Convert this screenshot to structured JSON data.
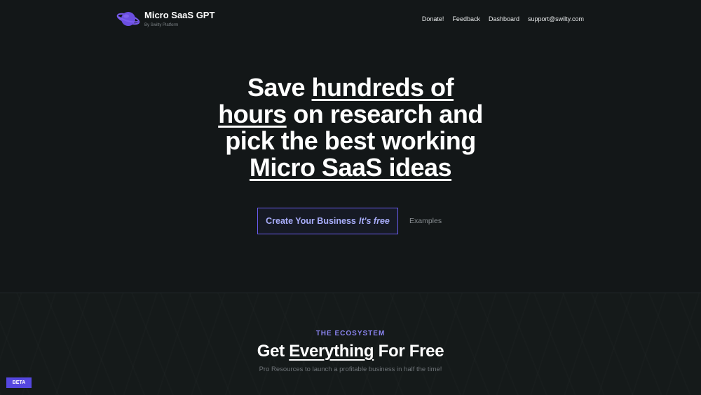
{
  "brand": {
    "name": "Micro SaaS GPT",
    "subtitle": "By Swilty Platform",
    "logo_icon": "planet-icon",
    "logo_color": "#6b4fe0"
  },
  "nav": {
    "items": [
      "Donate!",
      "Feedback",
      "Dashboard",
      "support@swilty.com"
    ]
  },
  "hero": {
    "title_parts": {
      "p1": "Save ",
      "p2": "hundreds of",
      "p3": "hours",
      "p4": " on research and",
      "p5": "pick the best working",
      "p6": "Micro SaaS ideas"
    },
    "cta_label": "Create Your Business",
    "cta_free": "It's free",
    "examples_label": "Examples"
  },
  "ecosystem": {
    "label": "THE ECOSYSTEM",
    "title_prefix": "Get ",
    "title_highlight": "Everything",
    "title_suffix": " For Free",
    "subtitle": "Pro Resources to launch a profitable business in half the time!"
  },
  "badge": {
    "label": "BETA"
  },
  "colors": {
    "background": "#131718",
    "accent": "#6a5cf0",
    "accent_text": "#a9aefc",
    "label": "#8b85f2"
  }
}
